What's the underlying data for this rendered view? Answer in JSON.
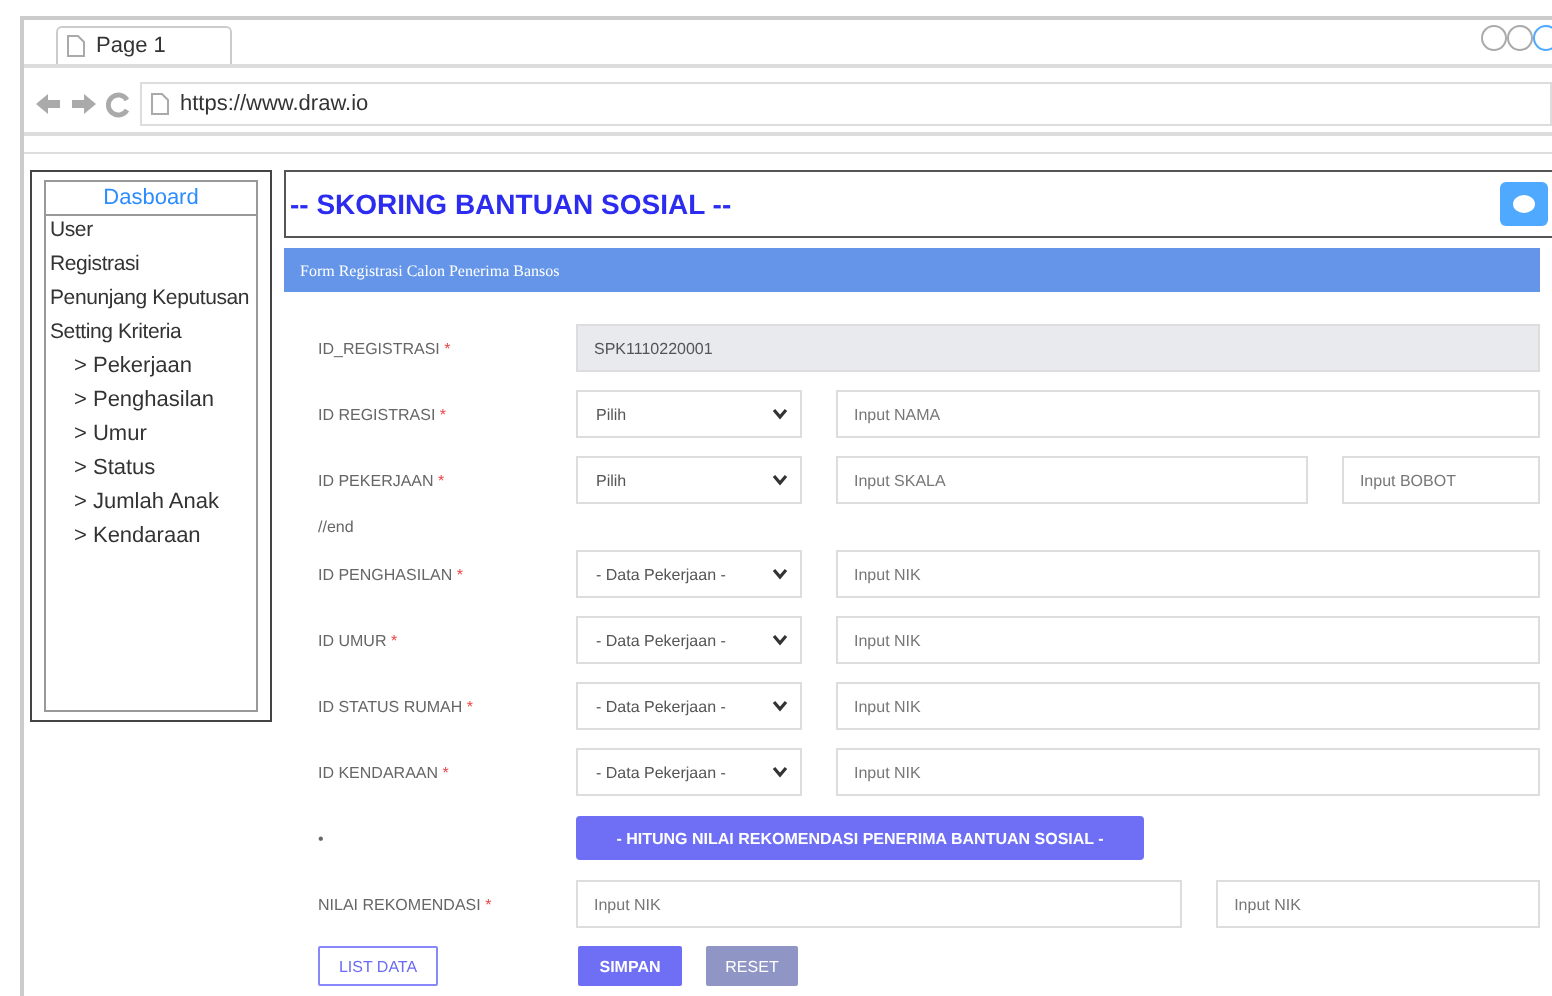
{
  "browser": {
    "tab_title": "Page 1",
    "url": "https://www.draw.io"
  },
  "sidebar": {
    "title": "Dasboard",
    "items": [
      {
        "label": "User"
      },
      {
        "label": "Registrasi"
      },
      {
        "label": "Penunjang Keputusan"
      },
      {
        "label": "Setting Kriteria",
        "children": [
          {
            "label": "> Pekerjaan"
          },
          {
            "label": "> Penghasilan"
          },
          {
            "label": "> Umur"
          },
          {
            "label": "> Status"
          },
          {
            "label": "> Jumlah Anak"
          },
          {
            "label": "> Kendaraan"
          }
        ]
      }
    ]
  },
  "header": {
    "title": "-- SKORING BANTUAN SOSIAL --"
  },
  "form": {
    "title": "Form Registrasi Calon Penerima Bansos",
    "rows": [
      {
        "kind": "field",
        "label": "ID_REGISTRASI",
        "required_mark": "*",
        "fields": [
          {
            "value": "SPK1110220001",
            "readonly": true
          }
        ]
      },
      {
        "kind": "field",
        "label": "ID REGISTRASI",
        "required_mark": "*",
        "select": "Pilih",
        "fields": [
          {
            "placeholder": "Input NAMA"
          }
        ]
      },
      {
        "kind": "field",
        "label": "ID PEKERJAAN",
        "required_mark": "*",
        "select": "Pilih",
        "fields": [
          {
            "placeholder": "Input SKALA"
          },
          {
            "placeholder": "Input BOBOT"
          }
        ]
      },
      {
        "kind": "note",
        "label": "//end"
      },
      {
        "kind": "field",
        "label": "ID PENGHASILAN",
        "required_mark": "*",
        "select": "- Data Pekerjaan -",
        "fields": [
          {
            "placeholder": "Input NIK"
          }
        ]
      },
      {
        "kind": "field",
        "label": "ID UMUR",
        "required_mark": "*",
        "select": "- Data Pekerjaan -",
        "fields": [
          {
            "placeholder": "Input NIK"
          }
        ]
      },
      {
        "kind": "field",
        "label": "ID STATUS RUMAH",
        "required_mark": "*",
        "select": "- Data Pekerjaan -",
        "fields": [
          {
            "placeholder": "Input NIK"
          }
        ]
      },
      {
        "kind": "field",
        "label": "ID KENDARAAN",
        "required_mark": "*",
        "select": "- Data Pekerjaan -",
        "fields": [
          {
            "placeholder": "Input NIK"
          }
        ]
      },
      {
        "kind": "action",
        "label": "•",
        "button": "- HITUNG NILAI REKOMENDASI PENERIMA BANTUAN SOSIAL -"
      },
      {
        "kind": "field",
        "label": "NILAI REKOMENDASI",
        "required_mark": "*",
        "fields": [
          {
            "placeholder": "Input NIK"
          },
          {
            "placeholder": "Input NIK"
          }
        ]
      },
      {
        "kind": "buttons",
        "buttons": [
          {
            "label": "LIST DATA",
            "kind": "outline"
          },
          {
            "label": "SIMPAN",
            "kind": "primary"
          },
          {
            "label": "RESET",
            "kind": "secondary"
          }
        ]
      }
    ]
  }
}
